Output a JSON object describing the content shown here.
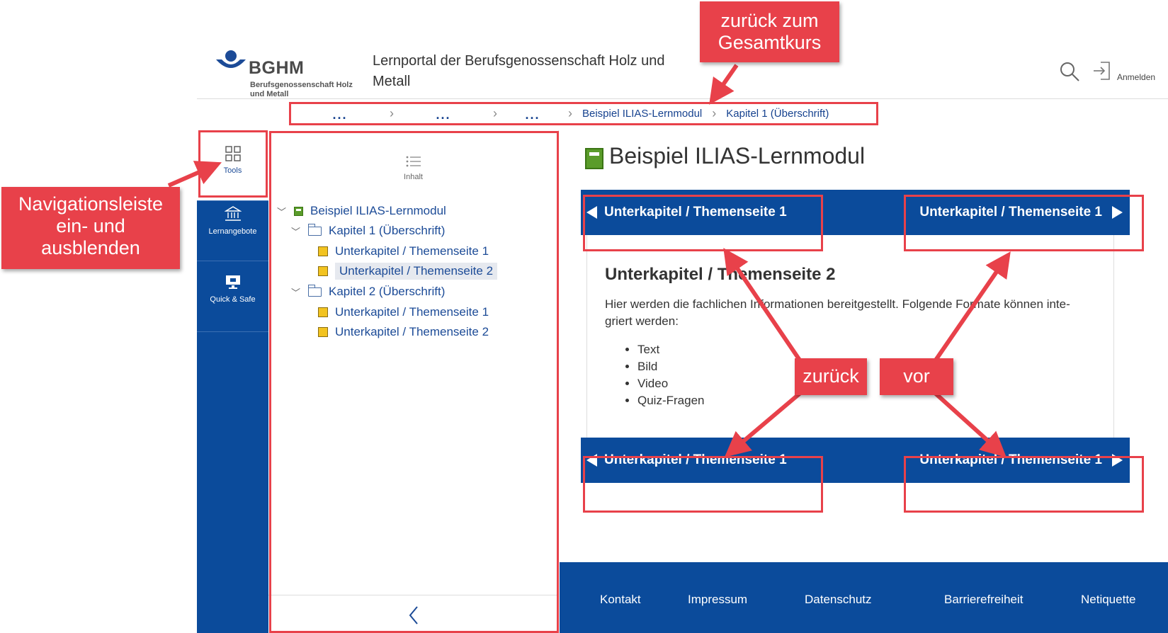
{
  "header": {
    "logo_abbr": "BGHM",
    "logo_sub": "Berufsgenossenschaft Holz und Metall",
    "portal_title": "Lernportal der Berufsgenossenschaft Holz und Metall",
    "search_icon": "search-icon",
    "login_icon": "login-icon",
    "login_label": "Anmelden"
  },
  "breadcrumb": {
    "dots": [
      "...",
      "...",
      "..."
    ],
    "items": [
      "Beispiel ILIAS-Lernmodul",
      "Kapitel 1 (Überschrift)"
    ]
  },
  "mainbar": {
    "items": [
      {
        "label": "Tools",
        "icon": "grid-icon"
      },
      {
        "label": "Lernangebote",
        "icon": "institution-icon"
      },
      {
        "label": "Quick & Safe",
        "icon": "monitor-icon"
      }
    ]
  },
  "slate": {
    "title": "Inhalt",
    "title_icon": "list-icon",
    "tree": [
      {
        "label": "Beispiel ILIAS-Lernmodul",
        "type": "module"
      },
      {
        "label": "Kapitel 1 (Überschrift)",
        "type": "chapter"
      },
      {
        "label": "Unterkapitel / Themenseite 1",
        "type": "page"
      },
      {
        "label": "Unterkapitel / Themenseite 2",
        "type": "page",
        "selected": true
      },
      {
        "label": "Kapitel 2 (Überschrift)",
        "type": "chapter"
      },
      {
        "label": "Unterkapitel / Themenseite 1",
        "type": "page"
      },
      {
        "label": "Unterkapitel / Themenseite 2",
        "type": "page"
      }
    ],
    "collapse_icon": "chevron-left-icon"
  },
  "content": {
    "title": "Beispiel ILIAS-Lernmodul",
    "prev_label": "Unterkapitel / Themenseite 1",
    "next_label": "Unterkapitel / Themenseite 1",
    "page_heading": "Unterkapitel / Themenseite 2",
    "page_text": "Hier werden die fachlichen Informationen bereitgestellt. Folgende Formate können inte-griert werden:",
    "list": [
      "Text",
      "Bild",
      "Video",
      "Quiz-Fragen"
    ]
  },
  "footer": {
    "links": [
      "Kontakt",
      "Impressum",
      "Datenschutz",
      "Barrierefreiheit",
      "Netiquette"
    ]
  },
  "annotations": {
    "back_to_course": "zurück zum Gesamtkurs",
    "toggle_nav": "Navigationsleiste ein- und ausblenden",
    "back": "zurück",
    "forward": "vor",
    "accent_color": "#e8414a"
  },
  "colors": {
    "primary": "#0b4b9b",
    "link": "#1c4b97",
    "module_green": "#5a9c2a",
    "page_yellow": "#f2c320"
  }
}
